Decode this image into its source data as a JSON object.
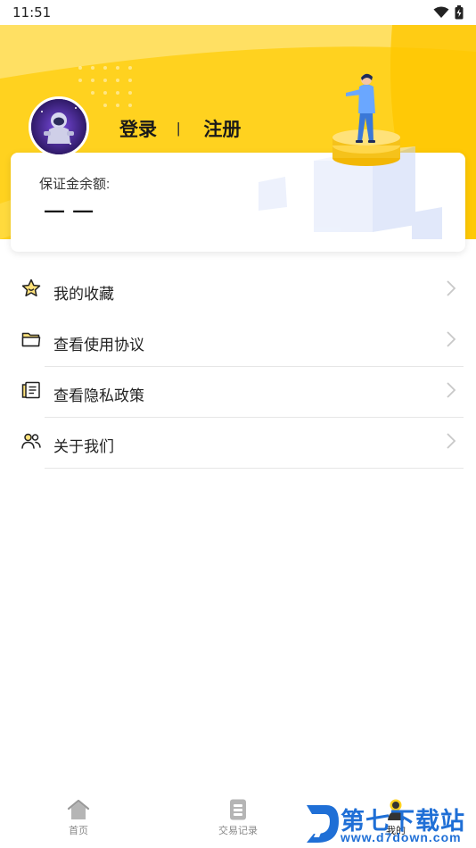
{
  "status_bar": {
    "time": "11:51"
  },
  "profile": {
    "login_label": "登录",
    "separator": "|",
    "register_label": "注册"
  },
  "deposit_card": {
    "label": "保证金余额:",
    "value": "— —"
  },
  "menu": {
    "items": [
      {
        "label": "我的收藏",
        "icon": "star-icon"
      },
      {
        "label": "查看使用协议",
        "icon": "folder-icon"
      },
      {
        "label": "查看隐私政策",
        "icon": "document-icon"
      },
      {
        "label": "关于我们",
        "icon": "users-icon"
      }
    ]
  },
  "tabbar": {
    "tabs": [
      {
        "label": "首页",
        "icon": "home-icon"
      },
      {
        "label": "交易记录",
        "icon": "list-icon"
      },
      {
        "label": "我的",
        "icon": "person-icon",
        "active": true
      }
    ]
  },
  "watermark": {
    "title": "第七下载站",
    "url": "www.d7down.com"
  },
  "colors": {
    "header_yellow": "#FFD21F",
    "header_light": "#FFE169",
    "link_blue": "#1F6FD6"
  }
}
